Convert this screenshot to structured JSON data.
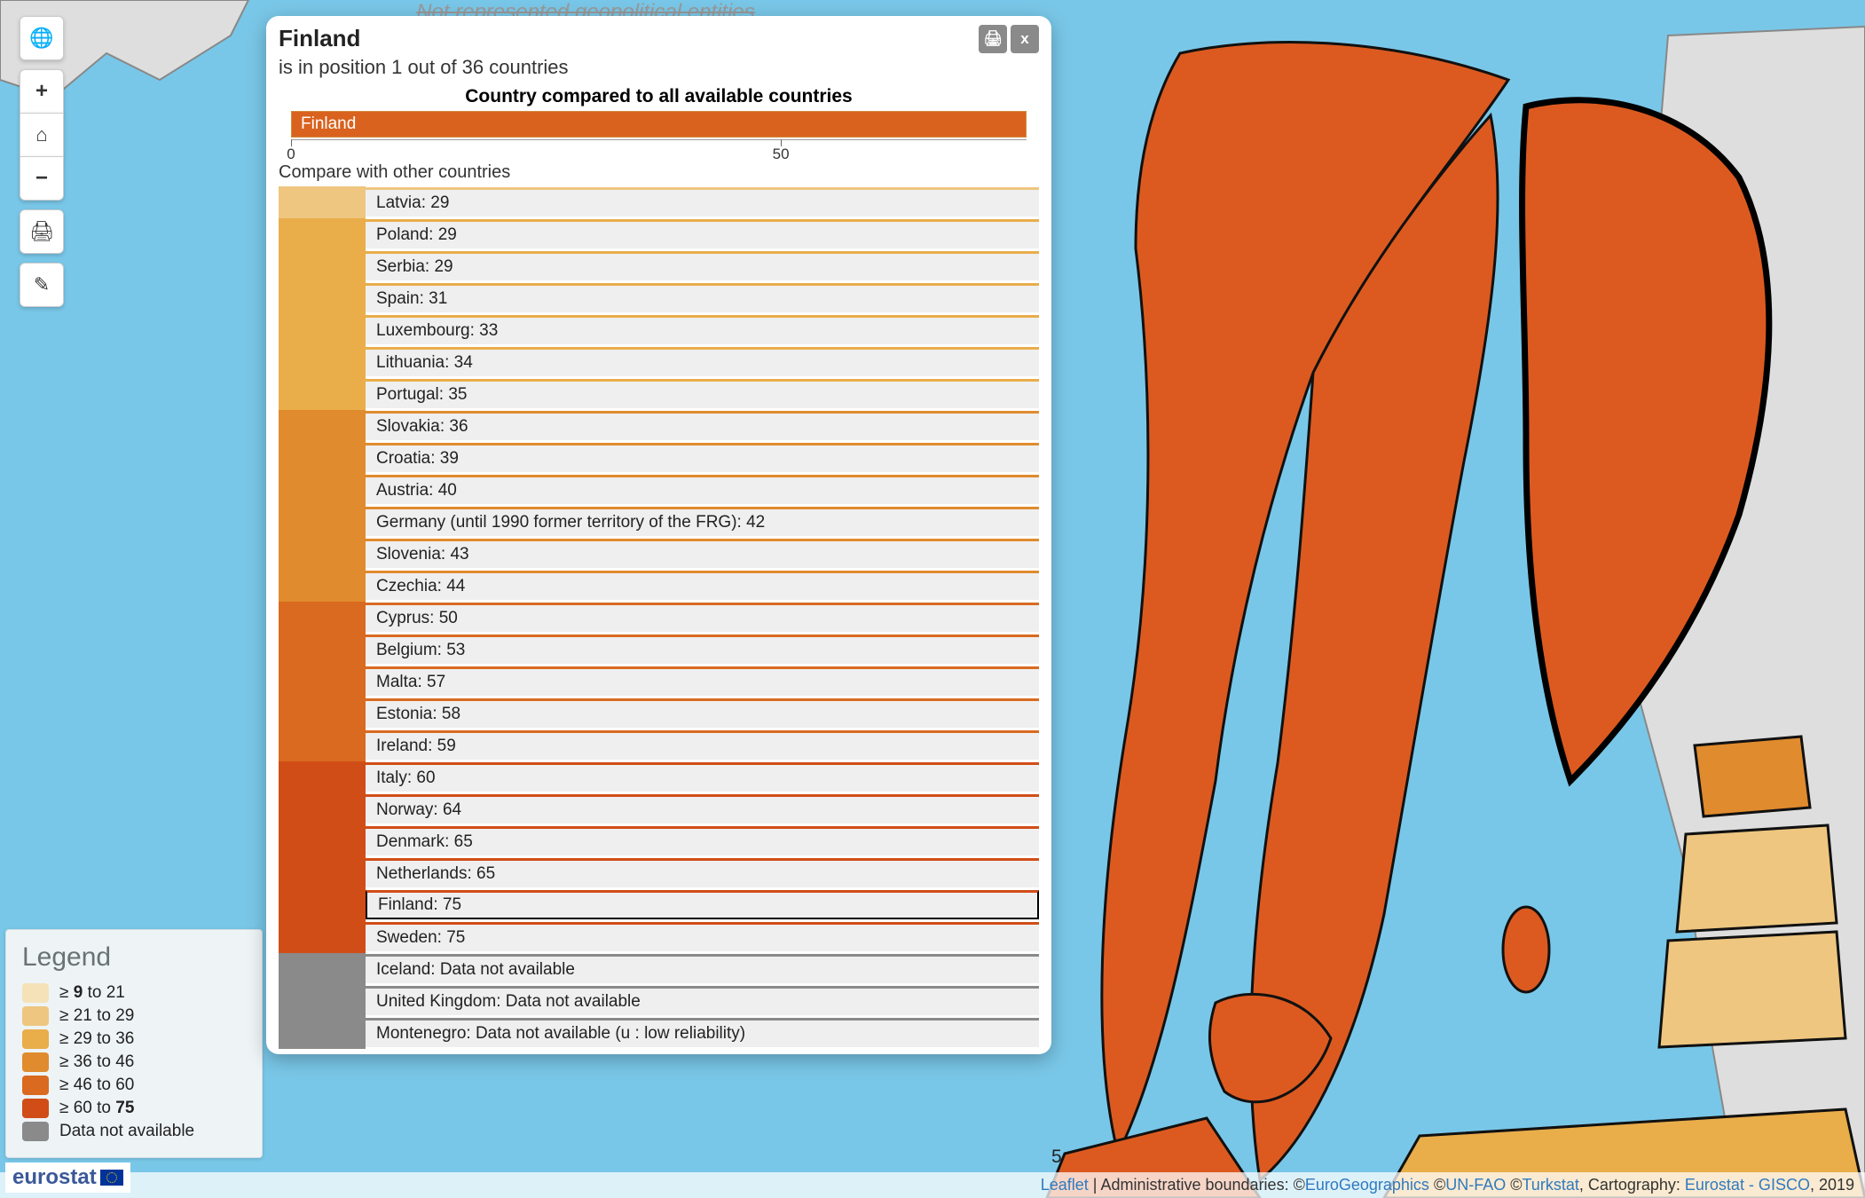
{
  "toolbar": {
    "globe": "🌐",
    "plus": "+",
    "home": "⌂",
    "minus": "−",
    "print": "🖨",
    "brush": "✎"
  },
  "legend": {
    "title": "Legend",
    "items": [
      {
        "color": "#f5e2b8",
        "label": "≥ 9 to 21",
        "bold_a": "9"
      },
      {
        "color": "#eec67f",
        "label": "≥ 21 to 29"
      },
      {
        "color": "#e9ad4a",
        "label": "≥ 29 to 36"
      },
      {
        "color": "#e08b2e",
        "label": "≥ 36 to 46"
      },
      {
        "color": "#d96a20",
        "label": "≥ 46 to 60"
      },
      {
        "color": "#d14d17",
        "label": "≥ 60 to 75",
        "bold_b": "75"
      },
      {
        "color": "#8a8a8a",
        "label": "Data not available"
      }
    ]
  },
  "greybar_text": "Not represented geopolitical entities",
  "eurostat_label": "eurostat",
  "attribution": {
    "leaflet": "Leaflet",
    "mid": " | Administrative boundaries: ©",
    "eurogeo": "EuroGeographics",
    "c1": " ©",
    "unfao": "UN-FAO",
    "c2": " ©",
    "turkstat": "Turkstat",
    "cart": ", Cartography: ",
    "gisco": "Eurostat - GISCO",
    "tail": ", 2019"
  },
  "stray_label": "5",
  "popup": {
    "title": "Finland",
    "subtitle": "is in position 1 out of 36 countries",
    "mini_title": "Country compared to all available countries",
    "main_bar_label": "Finland",
    "axis": {
      "v0": "0",
      "v50": "50"
    },
    "compare_hint": "Compare with other countries",
    "icons": {
      "print": "🖨",
      "close": "x"
    }
  },
  "chart_data": {
    "type": "bar",
    "title": "Country compared to all available countries",
    "xlabel": "",
    "ylabel": "",
    "xlim": [
      0,
      100
    ],
    "selected": "Finland",
    "selected_value": 75,
    "bins": [
      {
        "min": 9,
        "max": 21,
        "color": "#f5e2b8"
      },
      {
        "min": 21,
        "max": 29,
        "color": "#eec67f"
      },
      {
        "min": 29,
        "max": 36,
        "color": "#e9ad4a"
      },
      {
        "min": 36,
        "max": 46,
        "color": "#e08b2e"
      },
      {
        "min": 46,
        "max": 60,
        "color": "#d96a20"
      },
      {
        "min": 60,
        "max": 75,
        "color": "#d14d17"
      }
    ],
    "na_color": "#8a8a8a",
    "series": [
      {
        "name": "Latvia",
        "value": 29,
        "label": "Latvia: 29",
        "bin": 1
      },
      {
        "name": "Poland",
        "value": 29,
        "label": "Poland: 29",
        "bin": 2
      },
      {
        "name": "Serbia",
        "value": 29,
        "label": "Serbia: 29",
        "bin": 2
      },
      {
        "name": "Spain",
        "value": 31,
        "label": "Spain: 31",
        "bin": 2
      },
      {
        "name": "Luxembourg",
        "value": 33,
        "label": "Luxembourg: 33",
        "bin": 2
      },
      {
        "name": "Lithuania",
        "value": 34,
        "label": "Lithuania: 34",
        "bin": 2
      },
      {
        "name": "Portugal",
        "value": 35,
        "label": "Portugal: 35",
        "bin": 2
      },
      {
        "name": "Slovakia",
        "value": 36,
        "label": "Slovakia: 36",
        "bin": 3
      },
      {
        "name": "Croatia",
        "value": 39,
        "label": "Croatia: 39",
        "bin": 3
      },
      {
        "name": "Austria",
        "value": 40,
        "label": "Austria: 40",
        "bin": 3
      },
      {
        "name": "Germany (until 1990 former territory of the FRG)",
        "value": 42,
        "label": "Germany (until 1990 former territory of the FRG): 42",
        "bin": 3
      },
      {
        "name": "Slovenia",
        "value": 43,
        "label": "Slovenia: 43",
        "bin": 3
      },
      {
        "name": "Czechia",
        "value": 44,
        "label": "Czechia: 44",
        "bin": 3
      },
      {
        "name": "Cyprus",
        "value": 50,
        "label": "Cyprus: 50",
        "bin": 4
      },
      {
        "name": "Belgium",
        "value": 53,
        "label": "Belgium: 53",
        "bin": 4
      },
      {
        "name": "Malta",
        "value": 57,
        "label": "Malta: 57",
        "bin": 4
      },
      {
        "name": "Estonia",
        "value": 58,
        "label": "Estonia: 58",
        "bin": 4
      },
      {
        "name": "Ireland",
        "value": 59,
        "label": "Ireland: 59",
        "bin": 4
      },
      {
        "name": "Italy",
        "value": 60,
        "label": "Italy: 60",
        "bin": 5
      },
      {
        "name": "Norway",
        "value": 64,
        "label": "Norway: 64",
        "bin": 5
      },
      {
        "name": "Denmark",
        "value": 65,
        "label": "Denmark: 65",
        "bin": 5
      },
      {
        "name": "Netherlands",
        "value": 65,
        "label": "Netherlands: 65",
        "bin": 5
      },
      {
        "name": "Finland",
        "value": 75,
        "label": "Finland: 75",
        "bin": 5,
        "selected": true
      },
      {
        "name": "Sweden",
        "value": 75,
        "label": "Sweden: 75",
        "bin": 5
      },
      {
        "name": "Iceland",
        "value": null,
        "label": "Iceland: Data not available",
        "bin": "na"
      },
      {
        "name": "United Kingdom",
        "value": null,
        "label": "United Kingdom: Data not available",
        "bin": "na"
      },
      {
        "name": "Montenegro",
        "value": null,
        "label": "Montenegro: Data not available (u : low reliability)",
        "bin": "na"
      }
    ]
  }
}
